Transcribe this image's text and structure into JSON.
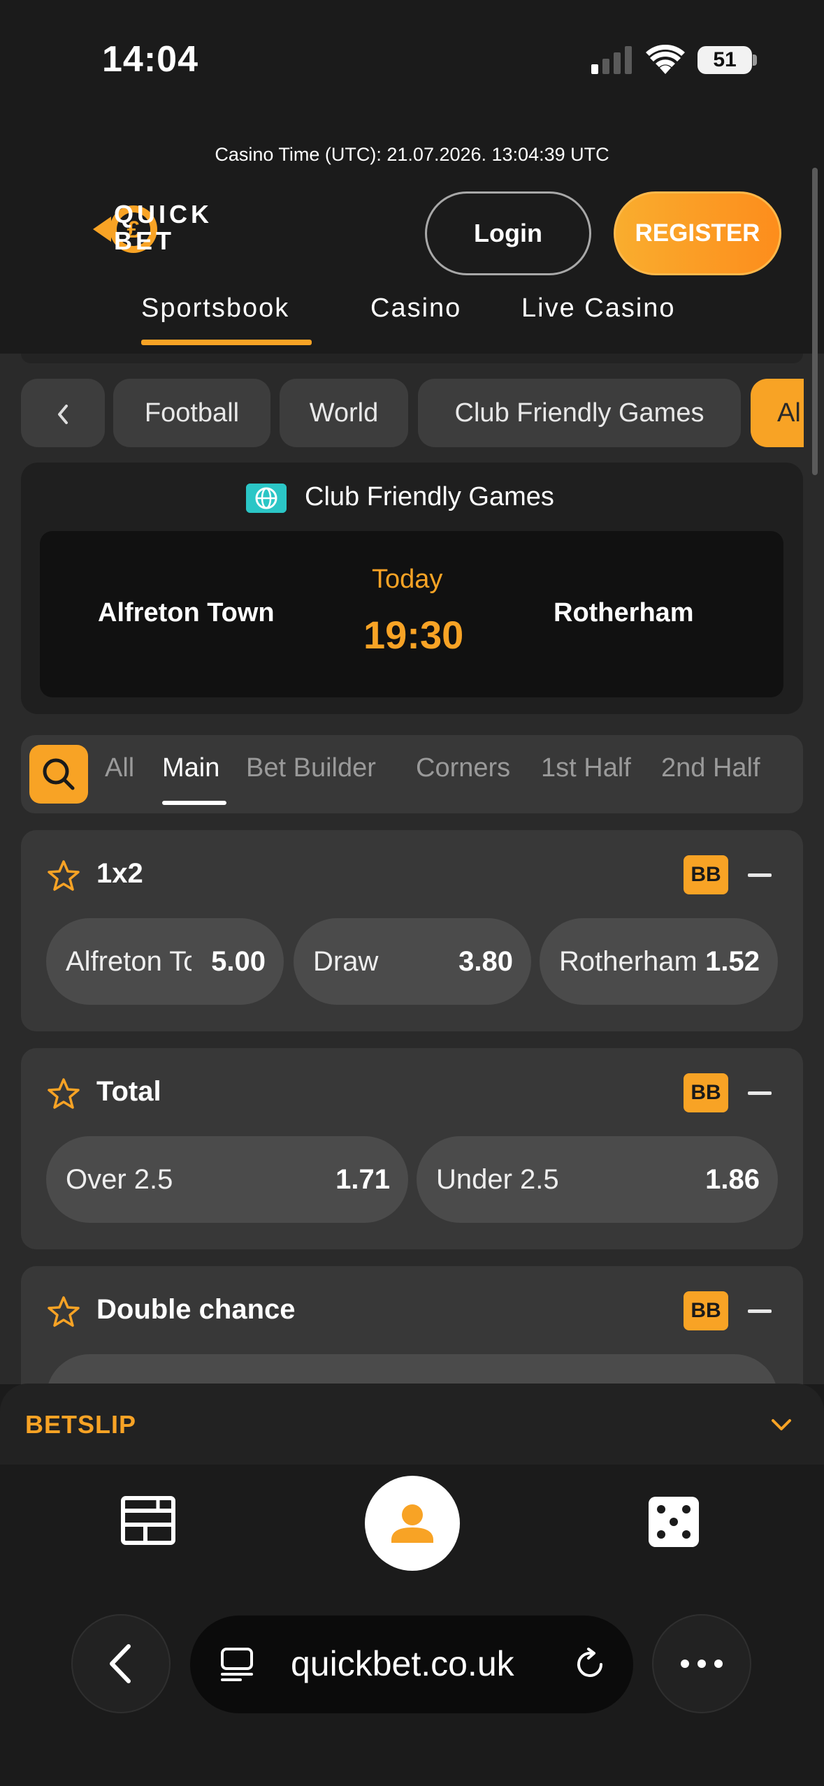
{
  "status_bar": {
    "time": "14:04",
    "battery": "51",
    "icons": [
      "cellular-signal-icon",
      "wifi-icon",
      "battery-icon"
    ]
  },
  "header": {
    "casino_time": "Casino Time (UTC): 21.07.2026. 13:04:39 UTC",
    "logo_line1": "QUICK",
    "logo_line2": "BET",
    "login_label": "Login",
    "register_label": "REGISTER",
    "main_tabs": [
      {
        "label": "Sportsbook",
        "active": true
      },
      {
        "label": "Casino",
        "active": false
      },
      {
        "label": "Live Casino",
        "active": false
      }
    ]
  },
  "breadcrumb": {
    "chips": [
      "Football",
      "World",
      "Club Friendly Games",
      "Al"
    ]
  },
  "match": {
    "league": "Club Friendly Games",
    "home_team": "Alfreton Town",
    "away_team": "Rotherham",
    "day": "Today",
    "time": "19:30"
  },
  "market_tabs": {
    "tabs": [
      "All",
      "Main",
      "Bet Builder",
      "Corners",
      "1st Half",
      "2nd Half"
    ],
    "active": "Main"
  },
  "markets": [
    {
      "title": "1x2",
      "badge": "BB",
      "odds": [
        {
          "label": "Alfreton Town",
          "price": "5.00"
        },
        {
          "label": "Draw",
          "price": "3.80"
        },
        {
          "label": "Rotherham",
          "price": "1.52"
        }
      ]
    },
    {
      "title": "Total",
      "badge": "BB",
      "odds": [
        {
          "label": "Over 2.5",
          "price": "1.71"
        },
        {
          "label": "Under 2.5",
          "price": "1.86"
        }
      ]
    },
    {
      "title": "Double chance",
      "badge": "BB",
      "odds": []
    }
  ],
  "betslip": {
    "label": "BETSLIP"
  },
  "bottom_nav": {
    "items": [
      "sportsbook-icon",
      "account-icon",
      "casino-dice-icon"
    ]
  },
  "browser": {
    "url": "quickbet.co.uk"
  },
  "colors": {
    "accent": "#f8a325",
    "background": "#1b1b1b",
    "panel": "#383838"
  }
}
